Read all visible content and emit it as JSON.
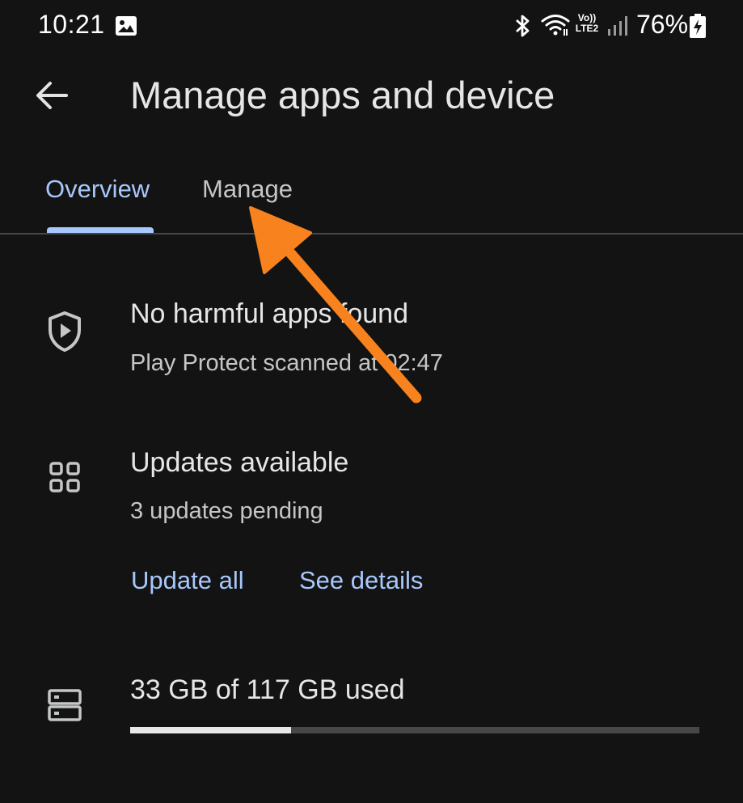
{
  "status_bar": {
    "time": "10:21",
    "battery_percent": "76%",
    "network_badge_top": "Vo))",
    "network_badge_bottom": "LTE2",
    "icons": [
      "gallery-icon",
      "bluetooth-icon",
      "wifi-icon",
      "signal-icon",
      "battery-charging-icon"
    ]
  },
  "header": {
    "back_icon": "arrow-back-icon",
    "title": "Manage apps and device"
  },
  "tabs": [
    {
      "label": "Overview",
      "selected": true
    },
    {
      "label": "Manage",
      "selected": false
    }
  ],
  "play_protect": {
    "icon": "shield-play-icon",
    "title": "No harmful apps found",
    "subtitle": "Play Protect scanned at 02:47"
  },
  "updates": {
    "icon": "apps-grid-icon",
    "title": "Updates available",
    "subtitle": "3 updates pending",
    "update_all_label": "Update all",
    "see_details_label": "See details"
  },
  "storage": {
    "icon": "storage-icon",
    "label": "33 GB of 117 GB used",
    "used_gb": 33,
    "total_gb": 117
  },
  "annotation": {
    "icon": "arrow-pointer-icon",
    "color": "#f7821e"
  },
  "colors": {
    "background": "#131313",
    "accent": "#a8c7fa",
    "text_primary": "#e6e6e6",
    "text_secondary": "#c4c7c5"
  }
}
